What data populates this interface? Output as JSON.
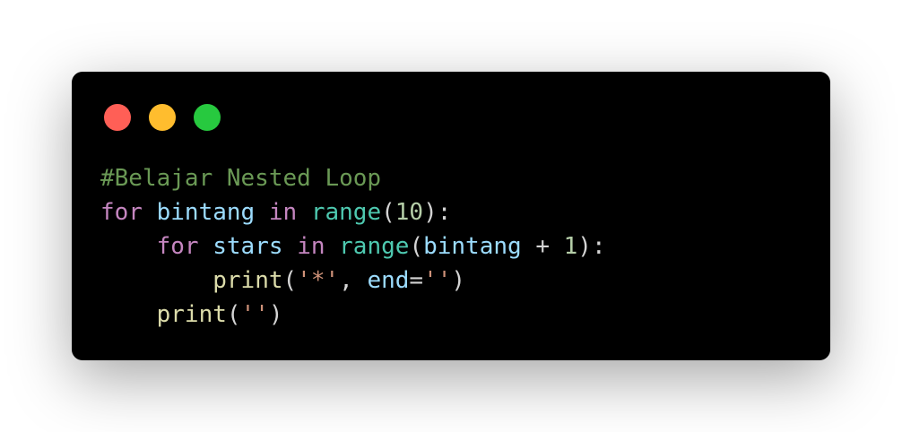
{
  "window": {
    "controls": [
      {
        "name": "close-dot",
        "color": "#ff5f56"
      },
      {
        "name": "minimize-dot",
        "color": "#ffbd2e"
      },
      {
        "name": "maximize-dot",
        "color": "#27c93f"
      }
    ]
  },
  "code": {
    "language": "python",
    "lines": [
      [
        {
          "type": "comment",
          "text": "#Belajar Nested Loop"
        }
      ],
      [
        {
          "type": "keyword",
          "text": "for"
        },
        {
          "type": "punct",
          "text": " "
        },
        {
          "type": "variable",
          "text": "bintang"
        },
        {
          "type": "punct",
          "text": " "
        },
        {
          "type": "keyword",
          "text": "in"
        },
        {
          "type": "punct",
          "text": " "
        },
        {
          "type": "builtin",
          "text": "range"
        },
        {
          "type": "punct",
          "text": "("
        },
        {
          "type": "number",
          "text": "10"
        },
        {
          "type": "punct",
          "text": "):"
        }
      ],
      [
        {
          "type": "punct",
          "text": "    "
        },
        {
          "type": "keyword",
          "text": "for"
        },
        {
          "type": "punct",
          "text": " "
        },
        {
          "type": "variable",
          "text": "stars"
        },
        {
          "type": "punct",
          "text": " "
        },
        {
          "type": "keyword",
          "text": "in"
        },
        {
          "type": "punct",
          "text": " "
        },
        {
          "type": "builtin",
          "text": "range"
        },
        {
          "type": "punct",
          "text": "("
        },
        {
          "type": "variable",
          "text": "bintang"
        },
        {
          "type": "punct",
          "text": " "
        },
        {
          "type": "operator",
          "text": "+"
        },
        {
          "type": "punct",
          "text": " "
        },
        {
          "type": "number",
          "text": "1"
        },
        {
          "type": "punct",
          "text": "):"
        }
      ],
      [
        {
          "type": "punct",
          "text": "        "
        },
        {
          "type": "function",
          "text": "print"
        },
        {
          "type": "punct",
          "text": "("
        },
        {
          "type": "string",
          "text": "'*'"
        },
        {
          "type": "punct",
          "text": ", "
        },
        {
          "type": "variable",
          "text": "end"
        },
        {
          "type": "operator",
          "text": "="
        },
        {
          "type": "string",
          "text": "''"
        },
        {
          "type": "punct",
          "text": ")"
        }
      ],
      [
        {
          "type": "punct",
          "text": "    "
        },
        {
          "type": "function",
          "text": "print"
        },
        {
          "type": "punct",
          "text": "("
        },
        {
          "type": "string",
          "text": "''"
        },
        {
          "type": "punct",
          "text": ")"
        }
      ]
    ]
  }
}
